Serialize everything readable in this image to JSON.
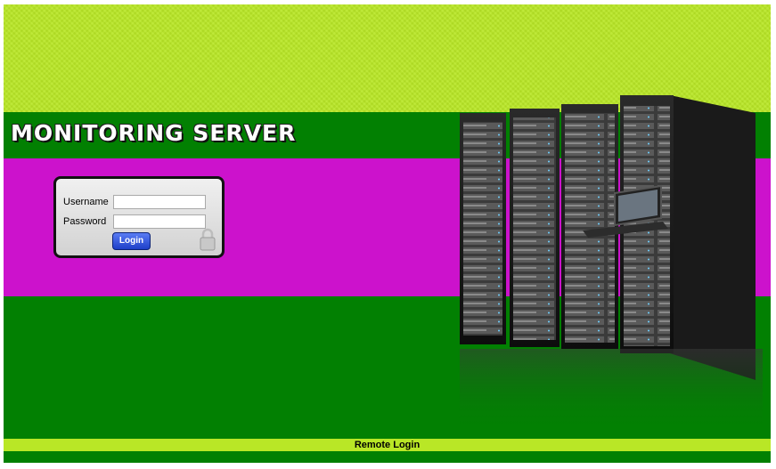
{
  "header": {
    "title": "MONITORING SERVER"
  },
  "login": {
    "username_label": "Username",
    "password_label": "Password",
    "username_value": "",
    "password_value": "",
    "button_label": "Login"
  },
  "footer": {
    "link_label": "Remote Login"
  },
  "colors": {
    "lime": "#b9e726",
    "green": "#028002",
    "magenta": "#cc12cc"
  },
  "icons": {
    "lock": "padlock-icon"
  }
}
